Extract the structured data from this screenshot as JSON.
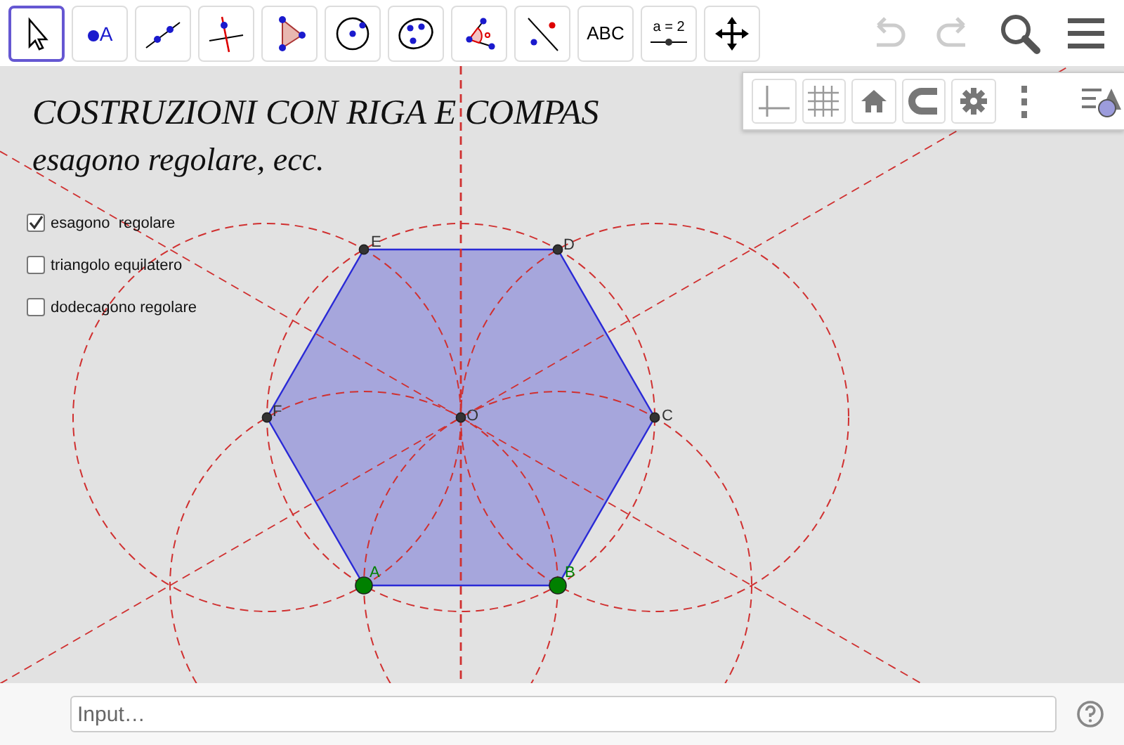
{
  "toolbar": {
    "tools": [
      {
        "kind": "move",
        "selected": true
      },
      {
        "kind": "point",
        "label": "A",
        "selected": false
      },
      {
        "kind": "line",
        "selected": false
      },
      {
        "kind": "perpendicular",
        "selected": false
      },
      {
        "kind": "polygon",
        "selected": false
      },
      {
        "kind": "circle",
        "selected": false
      },
      {
        "kind": "conic",
        "selected": false
      },
      {
        "kind": "angle",
        "selected": false
      },
      {
        "kind": "reflect",
        "selected": false
      },
      {
        "kind": "text",
        "label": "ABC",
        "selected": false
      },
      {
        "kind": "slider",
        "label": "a = 2",
        "selected": false
      },
      {
        "kind": "pan",
        "selected": false
      }
    ],
    "actions": [
      {
        "kind": "undo",
        "disabled": true
      },
      {
        "kind": "redo",
        "disabled": true
      },
      {
        "kind": "search",
        "disabled": false
      },
      {
        "kind": "menu",
        "disabled": false
      }
    ]
  },
  "style_bar": {
    "buttons": [
      {
        "kind": "axes"
      },
      {
        "kind": "grid"
      },
      {
        "kind": "home"
      },
      {
        "kind": "magnet"
      },
      {
        "kind": "settings"
      },
      {
        "kind": "more"
      },
      {
        "kind": "toggle"
      }
    ]
  },
  "title": "COSTRUZIONI CON RIGA E COMPAS",
  "subtitle": "esagono regolare, ecc.",
  "checkboxes": [
    {
      "label": "esagono  regolare",
      "checked": true
    },
    {
      "label": "triangolo equilatero",
      "checked": false
    },
    {
      "label": "dodecagono regolare",
      "checked": false
    }
  ],
  "points": [
    {
      "label": "A",
      "color": "#008000"
    },
    {
      "label": "B",
      "color": "#008000"
    },
    {
      "label": "C",
      "color": "#333333"
    },
    {
      "label": "D",
      "color": "#333333"
    },
    {
      "label": "E",
      "color": "#333333"
    },
    {
      "label": "F",
      "color": "#333333"
    },
    {
      "label": "O",
      "color": "#333333"
    }
  ],
  "input_bar": {
    "placeholder": "Input…"
  }
}
